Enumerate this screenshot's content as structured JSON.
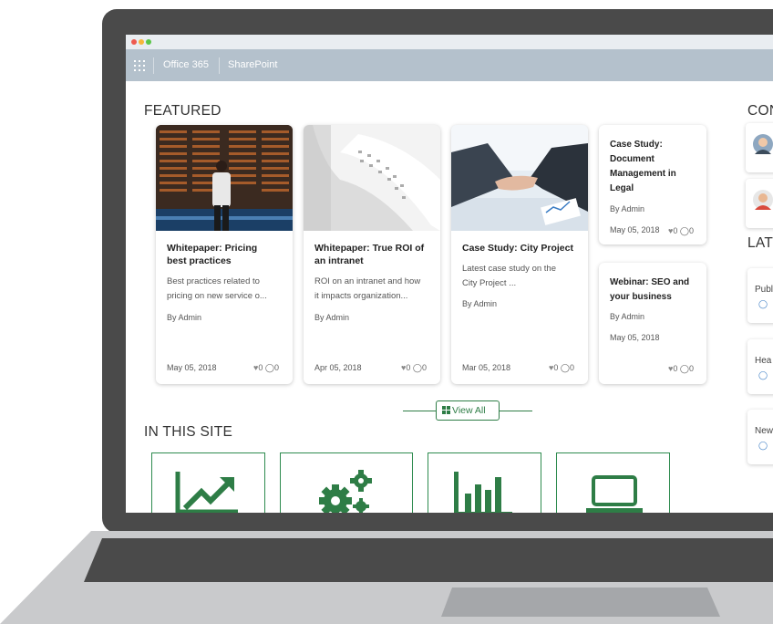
{
  "suite_bar": {
    "app_launcher_icon": "waffle-grid-icon",
    "brand": "Office 365",
    "site": "SharePoint"
  },
  "featured": {
    "heading": "FEATURED",
    "cards": [
      {
        "title_line1": "Whitepaper: Pricing",
        "title_line2": "best practices",
        "desc_line1": "Best practices related to",
        "desc_line2": "pricing on new service o...",
        "author": "By Admin",
        "date": "May 05, 2018",
        "likes": "0",
        "comments": "0",
        "image": "airport-departures-board"
      },
      {
        "title_line1": "Whitepaper: True ROI of",
        "title_line2": "an intranet",
        "desc_line1": "ROI on an intranet and how",
        "desc_line2": "it impacts organization...",
        "author": "By Admin",
        "date": "Apr 05, 2018",
        "likes": "0",
        "comments": "0",
        "image": "receipt-paper-roll"
      },
      {
        "title_line1": "Case Study: City Project",
        "desc_line1": "Latest case study on the",
        "desc_line2": "City Project ...",
        "author": "By Admin",
        "date": "Mar 05, 2018",
        "likes": "0",
        "comments": "0",
        "image": "business-handshake"
      }
    ],
    "small_cards": [
      {
        "title_line1": "Case Study:",
        "title_line2": "Document",
        "title_line3": "Management in",
        "title_line4": "Legal",
        "author": "By Admin",
        "date": "May 05, 2018",
        "likes": "0",
        "comments": "0"
      },
      {
        "title_line1": "Webinar: SEO and",
        "title_line2": "your business",
        "author": "By Admin",
        "date": "May 05, 2018",
        "likes": "0",
        "comments": "0"
      }
    ],
    "view_all": "View All"
  },
  "in_this_site": {
    "heading": "IN THIS SITE",
    "tiles": [
      {
        "icon": "trend-up-chart-icon"
      },
      {
        "icon": "gears-icon"
      },
      {
        "icon": "bar-chart-icon"
      },
      {
        "icon": "laptop-icon"
      }
    ]
  },
  "sidebar": {
    "contacts_heading": "CON",
    "latest_heading": "LAT",
    "latest_items": [
      {
        "label": "Publ"
      },
      {
        "label": "Hea"
      },
      {
        "label": "New"
      }
    ]
  },
  "colors": {
    "accent_green": "#2e7d46",
    "suite_bar": "#b4c1cc",
    "laptop_frame": "#4a4a4a"
  }
}
